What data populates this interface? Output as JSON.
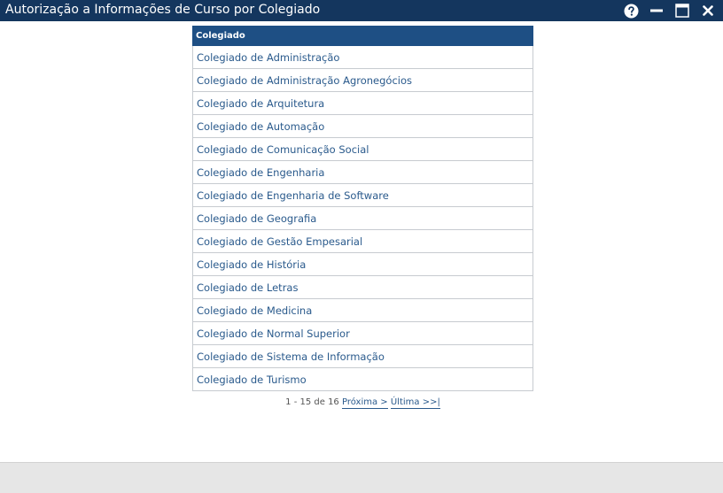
{
  "window": {
    "title": "Autorização a Informações de Curso por Colegiado",
    "controls": {
      "help_icon": "question-circle-icon",
      "minimize_icon": "minimize-icon",
      "maximize_icon": "maximize-icon",
      "close_icon": "close-icon"
    },
    "colors": {
      "titlebar": "#14365e",
      "table_header": "#1e4f84",
      "link": "#2a5a8c",
      "footer": "#e6e6e6"
    }
  },
  "table": {
    "header": "Colegiado",
    "rows": [
      "Colegiado de Administração",
      "Colegiado de Administração Agronegócios",
      "Colegiado de Arquitetura",
      "Colegiado de Automação",
      "Colegiado de Comunicação Social",
      "Colegiado de Engenharia",
      "Colegiado de Engenharia de Software",
      "Colegiado de Geografia",
      "Colegiado de Gestão Empesarial",
      "Colegiado de História",
      "Colegiado de Letras",
      "Colegiado de Medicina",
      "Colegiado de Normal Superior",
      "Colegiado de Sistema de Informação",
      "Colegiado de Turismo"
    ]
  },
  "pager": {
    "summary": "1 - 15 de 16",
    "next": "Próxima >",
    "last": "Última >>|"
  }
}
